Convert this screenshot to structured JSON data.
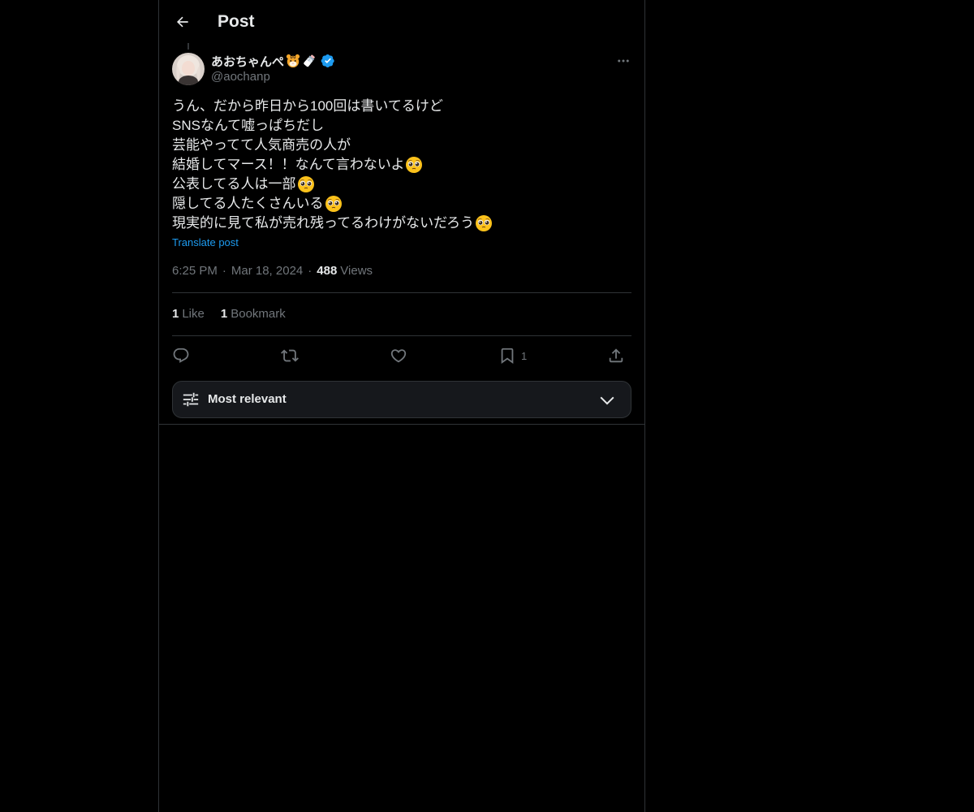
{
  "header": {
    "title": "Post"
  },
  "author": {
    "display_name": "あおちゃんぺ",
    "handle": "@aochanp",
    "verified": true
  },
  "post": {
    "lines": [
      "うん、だから昨日から100回は書いてるけど",
      "SNSなんて嘘っぱちだし",
      "芸能やってて人気商売の人が",
      "結婚してマース！！なんて言わないよ",
      "公表してる人は一部",
      "隠してる人たくさんいる",
      "現実的に見て私が売れ残ってるわけがないだろう"
    ],
    "translate_label": "Translate post",
    "time": "6:25 PM",
    "date": "Mar 18, 2024",
    "views_count": "488",
    "views_label": "Views",
    "separator": "·"
  },
  "stats": {
    "likes_count": "1",
    "likes_label": "Like",
    "bookmarks_count": "1",
    "bookmarks_label": "Bookmark"
  },
  "actions": {
    "bookmark_count": "1"
  },
  "replies_sort": {
    "label": "Most relevant"
  },
  "colors": {
    "background": "#000000",
    "text_primary": "#e7e9ea",
    "text_secondary": "#71767b",
    "link": "#1d9bf0",
    "border": "#2f3336",
    "verified": "#1d9bf0"
  }
}
